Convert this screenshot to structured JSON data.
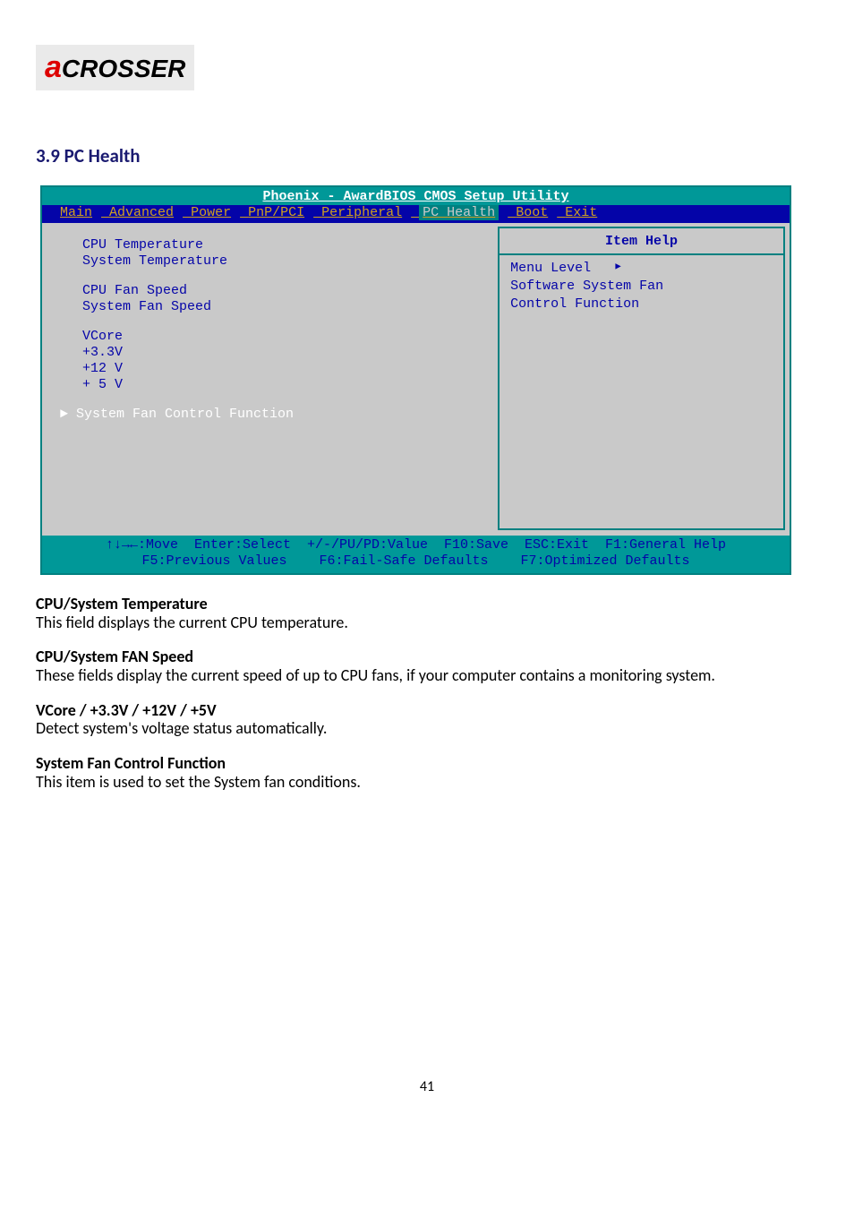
{
  "logo": {
    "red_char": "a",
    "rest": "CROSSER"
  },
  "section_title": "3.9 PC Health",
  "bios": {
    "title": "Phoenix - AwardBIOS CMOS Setup Utility",
    "menu": {
      "items": [
        "Main",
        "Advanced",
        "Power",
        "PnP/PCI",
        "Peripheral"
      ],
      "active": "PC Health",
      "items_after": [
        "Boot",
        "Exit"
      ]
    },
    "left_rows": [
      "CPU Temperature",
      "System Temperature",
      "",
      "CPU Fan Speed",
      "System Fan Speed",
      "",
      "VCore",
      "+3.3V",
      "+12 V",
      "+ 5 V"
    ],
    "submenu": "► System Fan Control Function",
    "help": {
      "title": "Item Help",
      "menu_level": "Menu Level",
      "desc1": "Software System Fan",
      "desc2": "Control Function"
    },
    "footer": {
      "line1": "↑↓→←:Move  Enter:Select  +/-/PU/PD:Value  F10:Save  ESC:Exit  F1:General Help",
      "line2": "F5:Previous Values    F6:Fail-Safe Defaults    F7:Optimized Defaults"
    }
  },
  "body": {
    "f1_title": "CPU/System Temperature",
    "f1_text": "This field displays the current CPU temperature.",
    "f2_title": "CPU/System FAN Speed",
    "f2_text": "These fields display the current speed of up to CPU fans, if your computer contains a monitoring system.",
    "f3_title": "VCore / +3.3V / +12V / +5V",
    "f3_text": "Detect system's voltage status automatically.",
    "f4_title": "System Fan Control Function",
    "f4_text": "This item is used to set the System fan conditions."
  },
  "page_footer": "41"
}
